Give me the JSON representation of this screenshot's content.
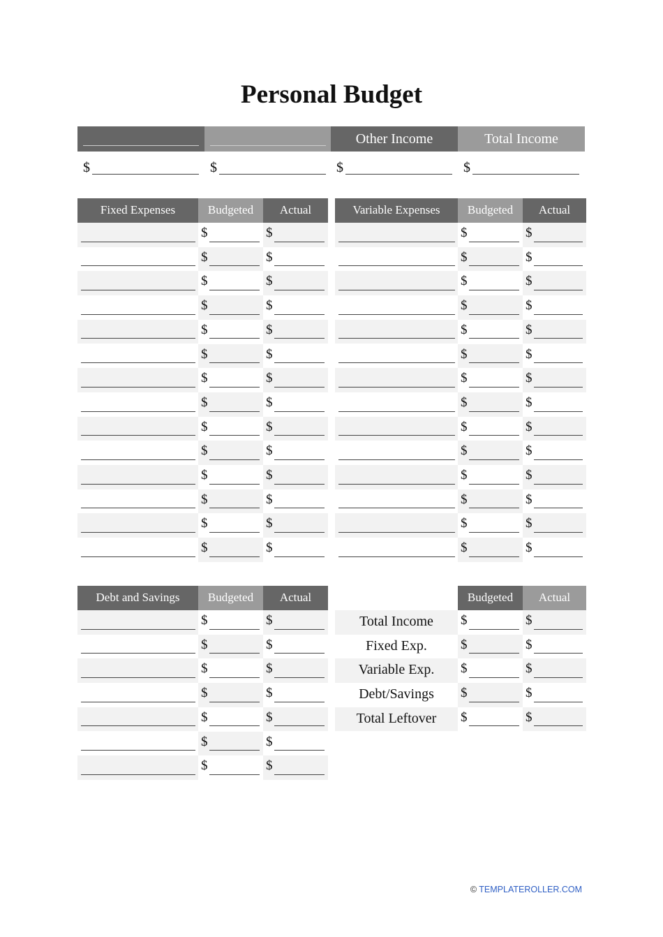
{
  "title": "Personal Budget",
  "income": {
    "headers": [
      {
        "label": "________________",
        "style": "dark",
        "blank": true
      },
      {
        "label": "________________",
        "style": "light",
        "blank": true
      },
      {
        "label": "Other Income",
        "style": "dark",
        "blank": false
      },
      {
        "label": "Total Income",
        "style": "light",
        "blank": false
      }
    ],
    "currency": "$",
    "values": [
      "",
      "",
      "",
      ""
    ]
  },
  "fixed_expenses": {
    "headers": {
      "name": "Fixed Expenses",
      "budgeted": "Budgeted",
      "actual": "Actual"
    },
    "row_count": 14
  },
  "variable_expenses": {
    "headers": {
      "name": "Variable Expenses",
      "budgeted": "Budgeted",
      "actual": "Actual"
    },
    "row_count": 14
  },
  "debt_and_savings": {
    "headers": {
      "name": "Debt and Savings",
      "budgeted": "Budgeted",
      "actual": "Actual"
    },
    "row_count": 7
  },
  "summary": {
    "headers": {
      "budgeted": "Budgeted",
      "actual": "Actual"
    },
    "rows": [
      "Total Income",
      "Fixed Exp.",
      "Variable Exp.",
      "Debt/Savings",
      "Total Leftover"
    ]
  },
  "currency_symbol": "$",
  "footer": {
    "copyright_symbol": "©",
    "text": "TEMPLATEROLLER.COM"
  }
}
